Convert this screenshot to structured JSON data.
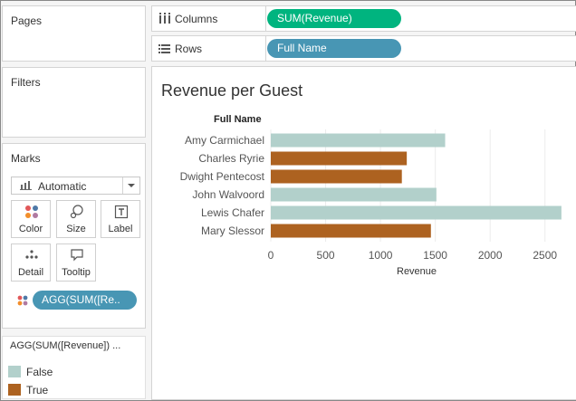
{
  "cards": {
    "pages": {
      "title": "Pages"
    },
    "filters": {
      "title": "Filters"
    },
    "marks": {
      "title": "Marks",
      "mark_type": "Automatic",
      "buttons": [
        {
          "label": "Color",
          "icon": "color-icon"
        },
        {
          "label": "Size",
          "icon": "size-icon"
        },
        {
          "label": "Label",
          "icon": "label-icon"
        },
        {
          "label": "Detail",
          "icon": "detail-icon"
        },
        {
          "label": "Tooltip",
          "icon": "tooltip-icon"
        }
      ],
      "color_field": "AGG(SUM([Re.."
    },
    "legend": {
      "title": "AGG(SUM([Revenue]) ...",
      "items": [
        {
          "label": "False",
          "color": "#b2d0cb"
        },
        {
          "label": "True",
          "color": "#ad6220"
        }
      ]
    }
  },
  "shelves": {
    "columns": {
      "label": "Columns",
      "pill": "SUM(Revenue)"
    },
    "rows": {
      "label": "Rows",
      "pill": "Full Name"
    }
  },
  "viz": {
    "title": "Revenue per Guest"
  },
  "chart_data": {
    "type": "bar",
    "orientation": "horizontal",
    "title": "Revenue per Guest",
    "category_header": "Full Name",
    "xlabel": "Revenue",
    "xlim": [
      0,
      2750
    ],
    "xticks": [
      0,
      500,
      1000,
      1500,
      2000,
      2500
    ],
    "grid": true,
    "categories": [
      "Amy Carmichael",
      "Charles Ryrie",
      "Dwight Pentecost",
      "John Walvoord",
      "Lewis Chafer",
      "Mary Slessor"
    ],
    "values": [
      1590,
      1240,
      1195,
      1510,
      2650,
      1460
    ],
    "flags": [
      false,
      true,
      true,
      false,
      false,
      true
    ],
    "colors": {
      "false": "#b2d0cb",
      "true": "#ad6220"
    }
  }
}
